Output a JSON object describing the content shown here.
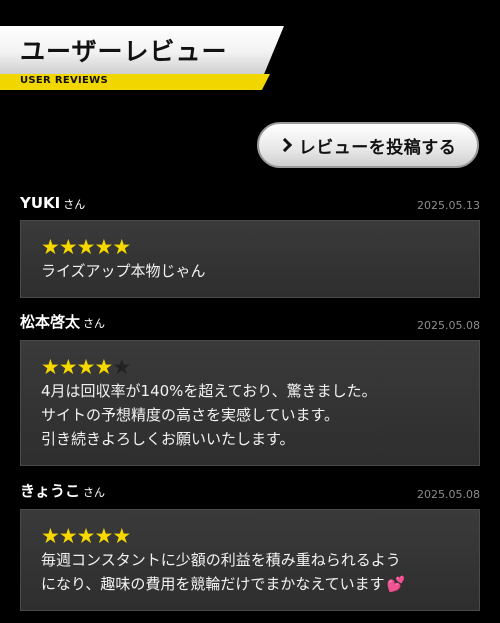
{
  "header": {
    "title": "ユーザーレビュー",
    "subtitle": "USER REVIEWS"
  },
  "post_button": {
    "label": "レビューを投稿する",
    "icon": "chevron-right-icon"
  },
  "colors": {
    "star": "#f5d800",
    "accent_yellow": "#f2d600",
    "heart": "#ff4f9a"
  },
  "reviews": [
    {
      "name": "YUKI",
      "honorific": "さん",
      "date": "2025.05.13",
      "rating": 5,
      "max_rating": 5,
      "lines": [
        "ライズアップ本物じゃん"
      ]
    },
    {
      "name": "松本啓太",
      "honorific": "さん",
      "date": "2025.05.08",
      "rating": 4,
      "max_rating": 5,
      "lines": [
        "4月は回収率が140%を超えており、驚きました。",
        "サイトの予想精度の高さを実感しています。",
        "引き続きよろしくお願いいたします。"
      ]
    },
    {
      "name": "きょうこ",
      "honorific": "さん",
      "date": "2025.05.08",
      "rating": 5,
      "max_rating": 5,
      "lines": [
        "毎週コンスタントに少額の利益を積み重ねられるよう",
        "になり、趣味の費用を競輪だけでまかなえています"
      ],
      "trailing_icon": "heart-icon"
    }
  ]
}
